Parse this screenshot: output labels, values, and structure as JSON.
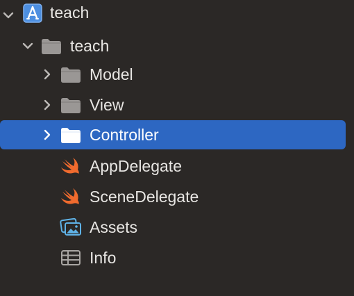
{
  "colors": {
    "background": "#2b2826",
    "selection": "#2d67c2",
    "folder": "#9a9795",
    "swift": "#f06b2e",
    "assets": "#5fb2e6"
  },
  "tree": {
    "project": {
      "label": "teach",
      "icon": "xcode-project-icon",
      "expanded": true
    },
    "group": {
      "label": "teach",
      "icon": "folder-icon",
      "expanded": true
    },
    "items": [
      {
        "label": "Model",
        "icon": "folder-icon",
        "disclosure": "collapsed"
      },
      {
        "label": "View",
        "icon": "folder-icon",
        "disclosure": "collapsed"
      },
      {
        "label": "Controller",
        "icon": "folder-icon",
        "disclosure": "collapsed",
        "selected": true
      },
      {
        "label": "AppDelegate",
        "icon": "swift-file-icon"
      },
      {
        "label": "SceneDelegate",
        "icon": "swift-file-icon"
      },
      {
        "label": "Assets",
        "icon": "asset-catalog-icon"
      },
      {
        "label": "Info",
        "icon": "plist-icon"
      }
    ]
  }
}
